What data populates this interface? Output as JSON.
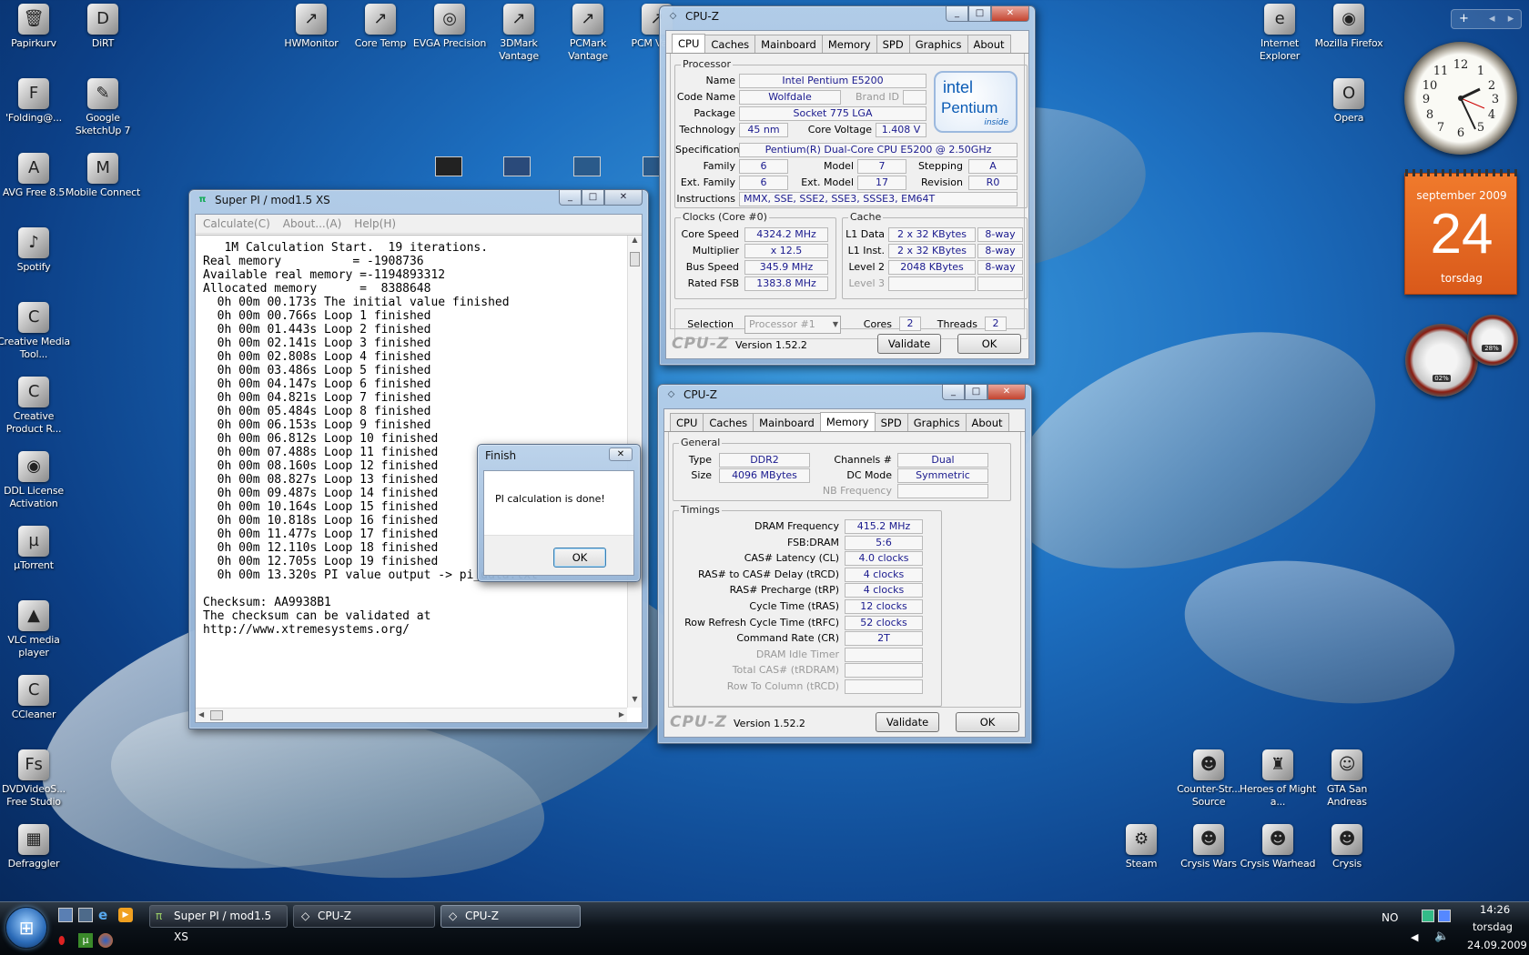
{
  "desktop": {
    "left_icons": [
      {
        "label": "Papirkurv",
        "glyph": "🗑"
      },
      {
        "label": "DiRT",
        "glyph": "D"
      },
      {
        "label": "'Folding@...",
        "glyph": "F"
      },
      {
        "label": "Google SketchUp 7",
        "glyph": "✎"
      },
      {
        "label": "AVG Free 8.5",
        "glyph": "A"
      },
      {
        "label": "Mobile Connect",
        "glyph": "M"
      },
      {
        "label": "Spotify",
        "glyph": "♪"
      },
      {
        "label": "Creative Media Tool...",
        "glyph": "C"
      },
      {
        "label": "Creative Product R...",
        "glyph": "C"
      },
      {
        "label": "DDL License Activation",
        "glyph": "◉"
      },
      {
        "label": "µTorrent",
        "glyph": "µ"
      },
      {
        "label": "VLC media player",
        "glyph": "▲"
      },
      {
        "label": "CCleaner",
        "glyph": "C"
      },
      {
        "label": "DVDVideoS... Free Studio",
        "glyph": "Fs"
      },
      {
        "label": "Defraggler",
        "glyph": "▦"
      }
    ],
    "top_icons": [
      {
        "label": "HWMonitor",
        "glyph": "↗"
      },
      {
        "label": "Core Temp",
        "glyph": "↗"
      },
      {
        "label": "EVGA Precision",
        "glyph": "◎"
      },
      {
        "label": "3DMark Vantage",
        "glyph": "↗"
      },
      {
        "label": "PCMark Vantage",
        "glyph": "↗"
      },
      {
        "label": "PCM Vanta",
        "glyph": "↗"
      }
    ],
    "right_icons": [
      {
        "label": "Internet Explorer",
        "glyph": "e"
      },
      {
        "label": "Mozilla Firefox",
        "glyph": "◉"
      },
      {
        "label": "Opera",
        "glyph": "O"
      }
    ],
    "bottom_right_icons": [
      {
        "label": "Counter-Str... Source",
        "glyph": "☻"
      },
      {
        "label": "Heroes of Might a...",
        "glyph": "♜"
      },
      {
        "label": "GTA San Andreas",
        "glyph": "☺"
      },
      {
        "label": "Steam",
        "glyph": "⚙"
      },
      {
        "label": "Crysis Wars",
        "glyph": "☻"
      },
      {
        "label": "Crysis Warhead",
        "glyph": "☻"
      },
      {
        "label": "Crysis",
        "glyph": "☻"
      }
    ]
  },
  "gadgets": {
    "calendar": {
      "month": "september 2009",
      "day": "24",
      "weekday": "torsdag"
    },
    "meter": {
      "cpu": "02%",
      "ram": "28%"
    }
  },
  "superpi": {
    "title": "Super PI / mod1.5 XS",
    "menu": [
      "Calculate(C)",
      "About...(A)",
      "Help(H)"
    ],
    "lines": [
      "   1M Calculation Start.  19 iterations.",
      "Real memory          = -1908736",
      "Available real memory =-1194893312",
      "Allocated memory      =  8388648",
      "  0h 00m 00.173s The initial value finished",
      "  0h 00m 00.766s Loop 1 finished",
      "  0h 00m 01.443s Loop 2 finished",
      "  0h 00m 02.141s Loop 3 finished",
      "  0h 00m 02.808s Loop 4 finished",
      "  0h 00m 03.486s Loop 5 finished",
      "  0h 00m 04.147s Loop 6 finished",
      "  0h 00m 04.821s Loop 7 finished",
      "  0h 00m 05.484s Loop 8 finished",
      "  0h 00m 06.153s Loop 9 finished",
      "  0h 00m 06.812s Loop 10 finished",
      "  0h 00m 07.488s Loop 11 finished",
      "  0h 00m 08.160s Loop 12 finished",
      "  0h 00m 08.827s Loop 13 finished",
      "  0h 00m 09.487s Loop 14 finished",
      "  0h 00m 10.164s Loop 15 finished",
      "  0h 00m 10.818s Loop 16 finished",
      "  0h 00m 11.477s Loop 17 finished",
      "  0h 00m 12.110s Loop 18 finished",
      "  0h 00m 12.705s Loop 19 finished",
      "  0h 00m 13.320s PI value output -> pi_data.txt",
      "",
      "Checksum: AA9938B1",
      "The checksum can be validated at",
      "http://www.xtremesystems.org/"
    ]
  },
  "finish_dialog": {
    "title": "Finish",
    "message": "PI calculation is done!",
    "ok": "OK"
  },
  "cpuz_cpu": {
    "title": "CPU-Z",
    "tabs": [
      "CPU",
      "Caches",
      "Mainboard",
      "Memory",
      "SPD",
      "Graphics",
      "About"
    ],
    "processor_group": "Processor",
    "name_label": "Name",
    "name": "Intel Pentium E5200",
    "codename_label": "Code Name",
    "codename": "Wolfdale",
    "brandid_label": "Brand ID",
    "package_label": "Package",
    "package": "Socket 775 LGA",
    "technology_label": "Technology",
    "technology": "45 nm",
    "corevoltage_label": "Core Voltage",
    "corevoltage": "1.408 V",
    "spec_label": "Specification",
    "spec": "Pentium(R) Dual-Core  CPU     E5200  @ 2.50GHz",
    "family_label": "Family",
    "family": "6",
    "model_label": "Model",
    "model": "7",
    "stepping_label": "Stepping",
    "stepping": "A",
    "extfamily_label": "Ext. Family",
    "extfamily": "6",
    "extmodel_label": "Ext. Model",
    "extmodel": "17",
    "revision_label": "Revision",
    "revision": "R0",
    "instructions_label": "Instructions",
    "instructions": "MMX, SSE, SSE2, SSE3, SSSE3, EM64T",
    "intel_logo": {
      "brand": "intel",
      "product": "Pentium",
      "suffix": "inside"
    },
    "clocks_group": "Clocks (Core #0)",
    "corespeed_label": "Core Speed",
    "corespeed": "4324.2 MHz",
    "multiplier_label": "Multiplier",
    "multiplier": "x 12.5",
    "busspeed_label": "Bus Speed",
    "busspeed": "345.9 MHz",
    "ratedfsb_label": "Rated FSB",
    "ratedfsb": "1383.8 MHz",
    "cache_group": "Cache",
    "l1data_label": "L1 Data",
    "l1data": "2 x 32 KBytes",
    "l1data_way": "8-way",
    "l1inst_label": "L1 Inst.",
    "l1inst": "2 x 32 KBytes",
    "l1inst_way": "8-way",
    "level2_label": "Level 2",
    "level2": "2048 KBytes",
    "level2_way": "8-way",
    "level3_label": "Level 3",
    "selection_label": "Selection",
    "selection": "Processor #1",
    "cores_label": "Cores",
    "cores": "2",
    "threads_label": "Threads",
    "threads": "2",
    "logo": "CPU-Z",
    "version": "Version 1.52.2",
    "validate": "Validate",
    "ok": "OK"
  },
  "cpuz_mem": {
    "title": "CPU-Z",
    "tabs": [
      "CPU",
      "Caches",
      "Mainboard",
      "Memory",
      "SPD",
      "Graphics",
      "About"
    ],
    "general_group": "General",
    "type_label": "Type",
    "type": "DDR2",
    "size_label": "Size",
    "size": "4096 MBytes",
    "channels_label": "Channels #",
    "channels": "Dual",
    "dcmode_label": "DC Mode",
    "dcmode": "Symmetric",
    "nbfreq_label": "NB Frequency",
    "timings_group": "Timings",
    "timings": [
      {
        "label": "DRAM Frequency",
        "value": "415.2 MHz",
        "dim": false
      },
      {
        "label": "FSB:DRAM",
        "value": "5:6",
        "dim": false
      },
      {
        "label": "CAS# Latency (CL)",
        "value": "4.0 clocks",
        "dim": false
      },
      {
        "label": "RAS# to CAS# Delay (tRCD)",
        "value": "4 clocks",
        "dim": false
      },
      {
        "label": "RAS# Precharge (tRP)",
        "value": "4 clocks",
        "dim": false
      },
      {
        "label": "Cycle Time (tRAS)",
        "value": "12 clocks",
        "dim": false
      },
      {
        "label": "Row Refresh Cycle Time (tRFC)",
        "value": "52 clocks",
        "dim": false
      },
      {
        "label": "Command Rate (CR)",
        "value": "2T",
        "dim": false
      },
      {
        "label": "DRAM Idle Timer",
        "value": "",
        "dim": true
      },
      {
        "label": "Total CAS# (tRDRAM)",
        "value": "",
        "dim": true
      },
      {
        "label": "Row To Column (tRCD)",
        "value": "",
        "dim": true
      }
    ],
    "logo": "CPU-Z",
    "version": "Version 1.52.2",
    "validate": "Validate",
    "ok": "OK"
  },
  "taskbar": {
    "buttons": [
      "Super PI / mod1.5 XS",
      "CPU-Z",
      "CPU-Z"
    ],
    "lang": "NO",
    "time": "14:26",
    "day": "torsdag",
    "date": "24.09.2009"
  }
}
